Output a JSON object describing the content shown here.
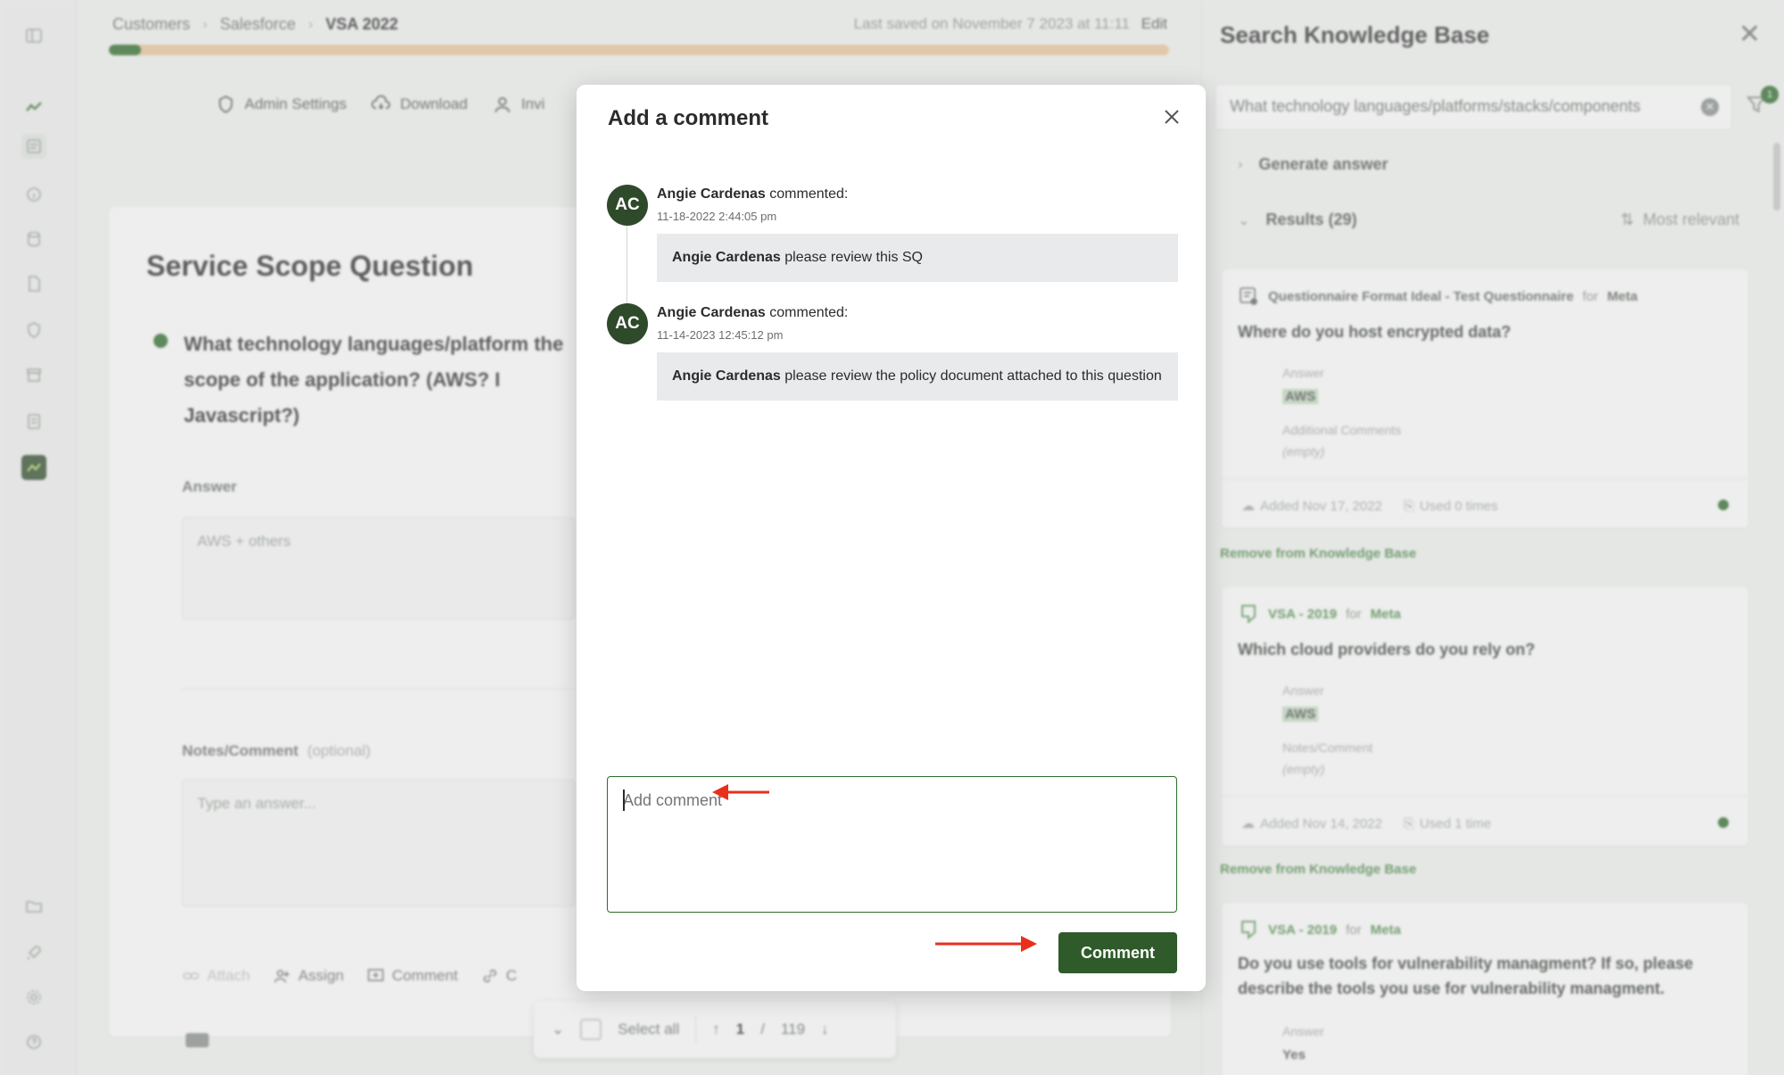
{
  "breadcrumb": {
    "items": [
      "Customers",
      "Salesforce",
      "VSA 2022"
    ]
  },
  "topbar": {
    "saved_text": "Last saved on November 7 2023 at 11:11",
    "edit_label": "Edit",
    "progress": 0.03
  },
  "toolbar": {
    "admin_settings": "Admin Settings",
    "download": "Download",
    "invite": "Invi"
  },
  "main": {
    "title": "Service Scope Question",
    "question": "What technology languages/platform the scope of the application? (AWS? I Javascript?)",
    "answer_label": "Answer",
    "answer_value": "AWS + others",
    "notes_label": "Notes/Comment",
    "notes_optional": "(optional)",
    "notes_placeholder": "Type an answer...",
    "actions": {
      "attach": "Attach",
      "assign": "Assign",
      "comment": "Comment",
      "copy": "C"
    }
  },
  "pager": {
    "select_all": "Select all",
    "current": "1",
    "separator": "/",
    "total": "119"
  },
  "right_panel": {
    "title": "Search Knowledge Base",
    "search_value": "What technology languages/platforms/stacks/components",
    "filter_count": "1",
    "generate_answer": "Generate answer",
    "results_label": "Results (29)",
    "sort_label": "Most relevant",
    "results": [
      {
        "source": "Questionnaire Format Ideal - Test Questionnaire",
        "for_label": "for",
        "customer": "Meta",
        "question": "Where do you host encrypted data?",
        "answer_label": "Answer",
        "answer": "AWS",
        "extra_label": "Additional Comments",
        "extra_value": "(empty)",
        "added": "Added Nov 17, 2022",
        "used": "Used 0 times",
        "remove": "Remove from Knowledge Base"
      },
      {
        "source": "VSA - 2019",
        "for_label": "for",
        "customer": "Meta",
        "question": "Which cloud providers do you rely on?",
        "answer_label": "Answer",
        "answer": "AWS",
        "extra_label": "Notes/Comment",
        "extra_value": "(empty)",
        "added": "Added Nov 14, 2022",
        "used": "Used 1 time",
        "remove": "Remove from Knowledge Base"
      },
      {
        "source": "VSA - 2019",
        "for_label": "for",
        "customer": "Meta",
        "question": "Do you use tools for vulnerability managment? If so, please describe the tools you use for vulnerability managment.",
        "answer_label": "Answer",
        "answer": "Yes"
      }
    ]
  },
  "modal": {
    "title": "Add a comment",
    "comments": [
      {
        "initials": "AC",
        "author": "Angie Cardenas",
        "verb": "commented:",
        "timestamp": "11-18-2022 2:44:05 pm",
        "mention": "Angie Cardenas",
        "text": "please review this SQ"
      },
      {
        "initials": "AC",
        "author": "Angie Cardenas",
        "verb": "commented:",
        "timestamp": "11-14-2023 12:45:12 pm",
        "mention": "Angie Cardenas",
        "text": "please review the policy document attached to this question"
      }
    ],
    "input_placeholder": "Add comment",
    "submit_label": "Comment"
  },
  "colors": {
    "brand_green": "#2f5a2a",
    "annotation_red": "#e8301c",
    "progress_track": "#ecc89b"
  }
}
